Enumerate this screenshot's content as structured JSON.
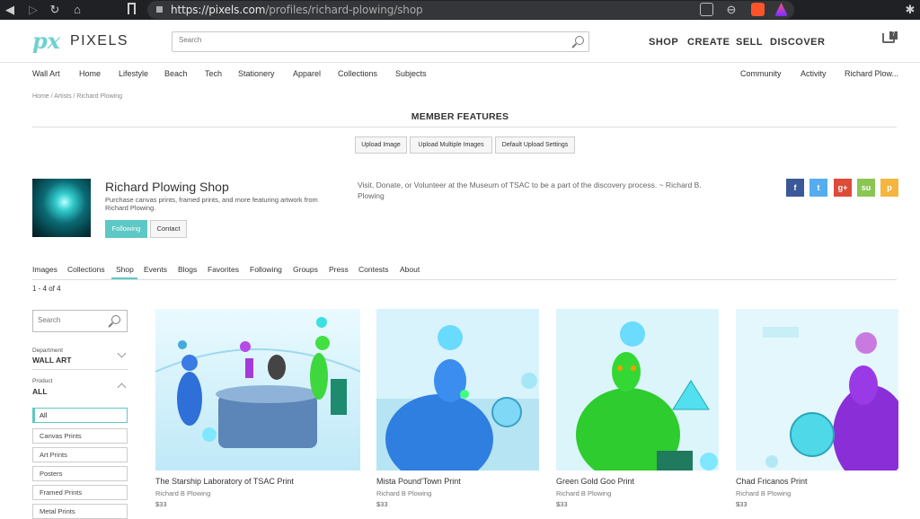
{
  "browser": {
    "url_host": "https://pixels.com",
    "url_path": "/profiles/richard-plowing/shop"
  },
  "header": {
    "logo_mark": "px",
    "logo_text": "PIXELS",
    "search_placeholder": "Search",
    "nav": [
      "SHOP",
      "CREATE",
      "SELL",
      "DISCOVER"
    ],
    "cart_count": "7"
  },
  "categories": [
    "Wall Art",
    "Home",
    "Lifestyle",
    "Beach",
    "Tech",
    "Stationery",
    "Apparel",
    "Collections",
    "Subjects"
  ],
  "right_links": [
    "Community",
    "Activity",
    "Richard Plow..."
  ],
  "breadcrumb": "Home / Artists / Richard Plowing",
  "member_features": {
    "title": "MEMBER FEATURES",
    "buttons": [
      "Upload Image",
      "Upload Multiple Images",
      "Default Upload Settings"
    ]
  },
  "profile": {
    "name": "Richard Plowing Shop",
    "description": "Purchase canvas prints, framed prints, and more featuring artwork from Richard Plowing.",
    "following_label": "Following",
    "contact_label": "Contact",
    "bio": "Visit, Donate, or Volunteer at the Museum of TSAC to be a part of the discovery process. ~ Richard B.  Plowing"
  },
  "social": [
    {
      "icon": "facebook-icon",
      "glyph": "f",
      "color": "#3b5998"
    },
    {
      "icon": "twitter-icon",
      "glyph": "t",
      "color": "#55acee"
    },
    {
      "icon": "google-plus-icon",
      "glyph": "g+",
      "color": "#dd4b39"
    },
    {
      "icon": "stumbleupon-icon",
      "glyph": "su",
      "color": "#8ac652"
    },
    {
      "icon": "pinterest-icon",
      "glyph": "p",
      "color": "#f4b63f"
    }
  ],
  "tabs": [
    "Images",
    "Collections",
    "Shop",
    "Events",
    "Blogs",
    "Favorites",
    "Following",
    "Groups",
    "Press",
    "Contests",
    "About"
  ],
  "active_tab": "Shop",
  "result_count": "1 - 4 of 4",
  "sidebar": {
    "search_placeholder": "Search",
    "department_label": "Department",
    "department_value": "WALL ART",
    "product_label": "Product",
    "product_value": "ALL",
    "product_options": [
      "All",
      "Canvas Prints",
      "Art Prints",
      "Posters",
      "Framed Prints",
      "Metal Prints"
    ]
  },
  "products": [
    {
      "title": "The Starship Laboratory of TSAC Print",
      "artist": "Richard B Plowing",
      "price": "$33"
    },
    {
      "title": "Mista Pound'Town Print",
      "artist": "Richard B Plowing",
      "price": "$33"
    },
    {
      "title": "Green Gold Goo Print",
      "artist": "Richard B Plowing",
      "price": "$33"
    },
    {
      "title": "Chad Fricanos Print",
      "artist": "Richard B Plowing",
      "price": "$33"
    }
  ],
  "colors": {
    "accent": "#5dc8c5",
    "logo": "#6fd1d0"
  }
}
